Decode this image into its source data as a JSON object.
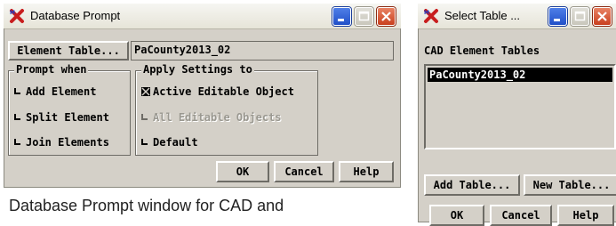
{
  "db_prompt": {
    "title": "Database Prompt",
    "element_table_button": "Element Table...",
    "element_table_value": "PaCounty2013_02",
    "prompt_when": {
      "label": "Prompt when",
      "options": [
        {
          "label": "Add Element",
          "checked": false
        },
        {
          "label": "Split Element",
          "checked": false
        },
        {
          "label": "Join Elements",
          "checked": false
        }
      ]
    },
    "apply_settings": {
      "label": "Apply Settings to",
      "options": [
        {
          "label": "Active Editable Object",
          "checked": true,
          "enabled": true
        },
        {
          "label": "All Editable Objects",
          "checked": false,
          "enabled": false
        },
        {
          "label": "Default",
          "checked": false,
          "enabled": true
        }
      ]
    },
    "buttons": {
      "ok": "OK",
      "cancel": "Cancel",
      "help": "Help"
    }
  },
  "select_table": {
    "title": "Select Table ...",
    "list_label": "CAD Element Tables",
    "items": [
      "PaCounty2013_02"
    ],
    "buttons": {
      "add_table": "Add Table...",
      "new_table": "New Table...",
      "ok": "OK",
      "cancel": "Cancel",
      "help": "Help"
    }
  },
  "caption": "Database Prompt window for CAD and",
  "colors": {
    "face": "#d4d0c8",
    "selected_bg": "#000000",
    "selected_fg": "#ffffff",
    "disabled_text": "#9a9890"
  }
}
